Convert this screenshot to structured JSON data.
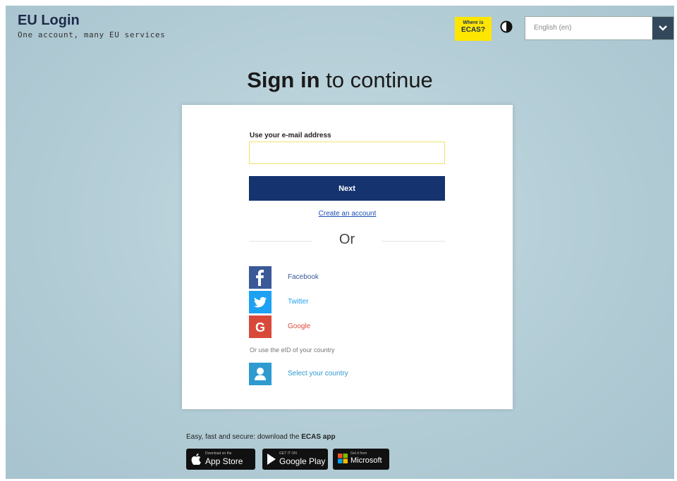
{
  "header": {
    "title": "EU Login",
    "subtitle": "One account, many EU services",
    "ecas_small": "Where is",
    "ecas_big": "ECAS?",
    "language": "English (en)"
  },
  "main": {
    "heading_bold": "Sign in",
    "heading_rest": " to continue",
    "email_label": "Use your e-mail address",
    "email_value": "",
    "next_label": "Next",
    "create_account": "Create an account",
    "or_label": "Or",
    "social": [
      {
        "label": "Facebook",
        "icon": "facebook-icon",
        "color": "#3b5998",
        "text_color": "#3b5998"
      },
      {
        "label": "Twitter",
        "icon": "twitter-icon",
        "color": "#1da1f2",
        "text_color": "#1da1f2"
      },
      {
        "label": "Google",
        "icon": "google-icon",
        "color": "#d9493a",
        "text_color": "#d9493a"
      }
    ],
    "eid_text": "Or use the eID of your country",
    "select_country": "Select your country"
  },
  "footer": {
    "download_text": "Easy, fast and secure: download the ",
    "download_app": "ECAS app",
    "stores": [
      {
        "small": "Download on the",
        "label": "App Store"
      },
      {
        "small": "GET IT ON",
        "label": "Google Play"
      },
      {
        "small": "Get it from",
        "label": "Microsoft"
      }
    ]
  },
  "colors": {
    "primary": "#15336e",
    "ecas_badge": "#ffe600",
    "select_country": "#2e9ad0"
  }
}
